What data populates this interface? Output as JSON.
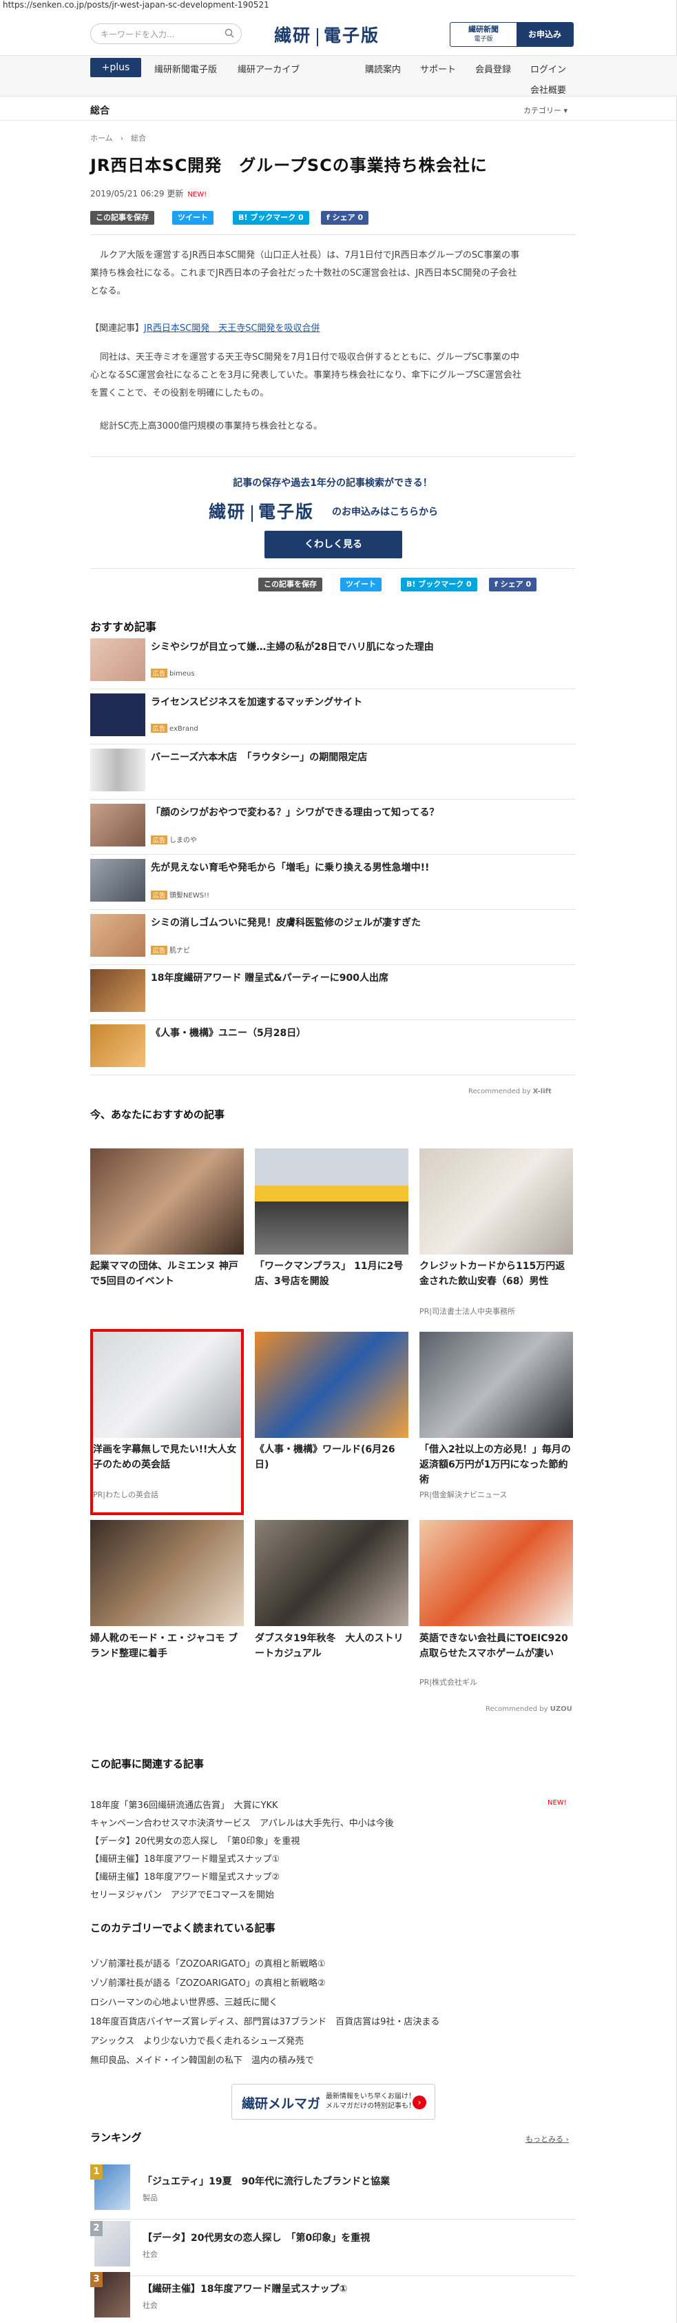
{
  "url": "https://senken.co.jp/posts/jr-west-japan-sc-development-190521",
  "header": {
    "search_placeholder": "キーワードを入力...",
    "logo_left": "繊研",
    "logo_right": "電子版",
    "apply_label_main": "繊研新聞",
    "apply_label_sub": "電子版",
    "apply_button": "お申込み"
  },
  "nav": {
    "plus": "+plus",
    "items": [
      "繊研新聞電子版",
      "繊研アーカイブ"
    ],
    "right_items": [
      "購読案内",
      "サポート",
      "会員登録",
      "ログイン"
    ],
    "company": "会社概要"
  },
  "category": {
    "title": "総合",
    "menu": "カテゴリー ▾"
  },
  "breadcrumb": "ホーム　›　総合",
  "article": {
    "title": "JR西日本SC開発　グループSCの事業持ち株会社に",
    "date": "2019/05/21 06:29 更新",
    "new": "NEW!",
    "share": {
      "save": "この記事を保存",
      "tweet": "ツイート",
      "bookmark": "B! ブックマーク 0",
      "fb": "f シェア 0"
    },
    "paragraphs": [
      "ルクア大阪を運営するJR西日本SC開発（山口正人社長）は、7月1日付でJR西日本グループのSC事業の事",
      "業持ち株会社になる。これまでJR西日本の子会社だった十数社のSC運営会社は、JR西日本SC開発の子会社",
      "となる。"
    ],
    "related_label": "【関連記事】",
    "related_link": "JR西日本SC開発　天王寺SC開発を吸収合併",
    "p2": [
      "同社は、天王寺ミオを運営する天王寺SC開発を7月1日付で吸収合併するとともに、グループSC事業の中",
      "心となるSC運営会社になることを3月に発表していた。事業持ち株会社になり、傘下にグループSC運営会社",
      "を置くことで、その役割を明確にしたもの。"
    ],
    "p3": "総計SC売上高3000億円規模の事業持ち株会社となる。"
  },
  "promo": {
    "headline": "記事の保存や過去1年分の記事検索ができる！",
    "logo_left": "繊研",
    "logo_right": "電子版",
    "sub": "のお申込みはこちらから",
    "button": "くわしく見る"
  },
  "recommend": {
    "title": "おすすめ記事",
    "pr": "広告",
    "items": [
      {
        "title": "シミやシワが目立って嫌…主婦の私が28日でハリ肌になった理由",
        "source": "bimeus"
      },
      {
        "title": "ライセンスビジネスを加速するマッチングサイト",
        "source": "exBrand"
      },
      {
        "title": "バーニーズ六本木店　「ラウタシー」の期間限定店",
        "source": ""
      },
      {
        "title": "「顔のシワがおやつで変わる？」シワができる理由って知ってる？",
        "source": "しまのや"
      },
      {
        "title": "先が見えない育毛や発毛から「増毛」に乗り換える男性急増中!!",
        "source": "頭髪NEWS!!"
      },
      {
        "title": "シミの消しゴムついに発見！皮膚科医監修のジェルが凄すぎた",
        "source": "肌ナビ"
      },
      {
        "title": "18年度繊研アワード 贈呈式&パーティーに900人出席",
        "source": ""
      },
      {
        "title": "《人事・機構》ユニー（5月28日）",
        "source": ""
      }
    ],
    "powered": "Recommended by",
    "powered_brand": "X-lift"
  },
  "for_you": {
    "title": "今、あなたにおすすめの記事",
    "items": [
      {
        "title": "起業ママの団体、ルミエンヌ 神戸で5回目のイベント",
        "pr": ""
      },
      {
        "title": "「ワークマンプラス」 11月に2号店、3号店を開設",
        "pr": ""
      },
      {
        "title": "クレジットカードから115万円返金された飲山安春（68）男性",
        "pr": "PR|司法書士法人中央事務所"
      },
      {
        "title": "洋画を字幕無しで見たい!!大人女子のための英会話",
        "pr": "PR|わたしの英会話"
      },
      {
        "title": "《人事・機構》ワールド(6月26日)",
        "pr": ""
      },
      {
        "title": "「借入2社以上の方必見！」毎月の返済額6万円が1万円になった節約術",
        "pr": "PR|借金解決ナビニュース"
      },
      {
        "title": "婦人靴のモード・エ・ジャコモ ブランド整理に着手",
        "pr": ""
      },
      {
        "title": "ダブスタ19年秋冬　大人のストリートカジュアル",
        "pr": ""
      },
      {
        "title": "英語できない会社員にTOEIC920点取らせたスマホゲームが凄い",
        "pr": "PR|株式会社ギル"
      }
    ],
    "powered": "Recommended by",
    "powered_brand": "UZOU"
  },
  "related": {
    "title": "この記事に関連する記事",
    "new": "NEW!",
    "items": [
      "18年度「第36回繊研流通広告賞」　大賞にYKK",
      "キャンペーン合わせスマホ決済サービス　アパレルは大手先行、中小は今後",
      "【データ】20代男女の恋人探し　「第0印象」を重視",
      "【繊研主催】18年度アワード贈呈式スナップ①",
      "【繊研主催】18年度アワード贈呈式スナップ②",
      "セリーヌジャパン　アジアでEコマースを開始"
    ]
  },
  "popular": {
    "title": "このカテゴリーでよく読まれている記事",
    "items": [
      "ゾゾ前澤社長が語る「ZOZOARIGATO」の真相と新戦略①",
      "ゾゾ前澤社長が語る「ZOZOARIGATO」の真相と新戦略②",
      "ロシハーマンの心地よい世界感、三越氏に聞く",
      "18年度百貨店バイヤーズ賞レディス、部門賞は37ブランド　百貨店賞は9社・店決まる",
      "アシックス　より少ない力で長く走れるシューズ発売",
      "無印良品、メイド・イン韓国創の私下　温内の積み残で"
    ]
  },
  "magazine": {
    "title": "繊研メルマガ",
    "desc1": "最新情報をいち早くお届け！",
    "desc2": "メルマガだけの特別記事も！"
  },
  "ranking": {
    "title": "ランキング",
    "more": "もっとみる ›",
    "items": [
      {
        "num": "1",
        "title": "「ジュエティ」19夏　90年代に流行したブランドと協業",
        "cat": "製品"
      },
      {
        "num": "2",
        "title": "【データ】20代男女の恋人探し　「第0印象」を重視",
        "cat": "社会"
      },
      {
        "num": "3",
        "title": "【繊研主催】18年度アワード贈呈式スナップ①",
        "cat": "社会"
      }
    ]
  },
  "colors": {
    "brand": "#1d3c6e",
    "accent_red": "#e60012"
  }
}
